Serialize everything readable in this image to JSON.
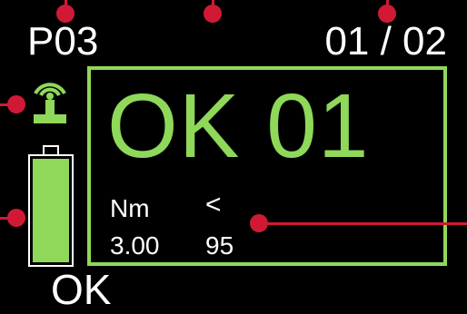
{
  "header": {
    "program": "P03",
    "counter": "01 / 02"
  },
  "result": {
    "label": "OK 01",
    "unit": "Nm",
    "comparator": "<",
    "torque": "3.00",
    "angle": "95"
  },
  "status": {
    "label": "OK"
  },
  "indicators": {
    "wireless": "wireless-signal-icon",
    "battery": "battery-icon",
    "battery_level": 1.0
  },
  "colors": {
    "ok_green": "#8fd85a",
    "background": "#000000",
    "text": "#ffffff",
    "annotation_red": "#d01a35"
  }
}
